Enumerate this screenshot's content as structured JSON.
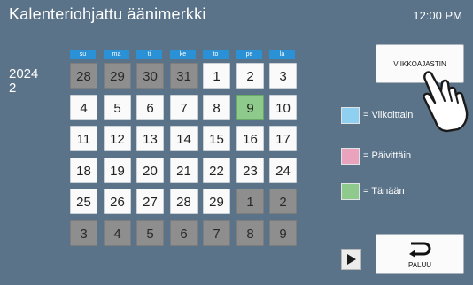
{
  "header": {
    "title": "Kalenteriohjattu äänimerkki",
    "clock": "12:00 PM"
  },
  "calendar": {
    "year": "2024",
    "month": "2",
    "weekdays": [
      "su",
      "ma",
      "ti",
      "ke",
      "to",
      "pe",
      "la"
    ],
    "days": [
      [
        "28",
        "29",
        "30",
        "31",
        "1",
        "2",
        "3"
      ],
      [
        "4",
        "5",
        "6",
        "7",
        "8",
        "9",
        "10"
      ],
      [
        "11",
        "12",
        "13",
        "14",
        "15",
        "16",
        "17"
      ],
      [
        "18",
        "19",
        "20",
        "21",
        "22",
        "23",
        "24"
      ],
      [
        "25",
        "26",
        "27",
        "28",
        "29",
        "1",
        "2"
      ],
      [
        "3",
        "4",
        "5",
        "6",
        "7",
        "8",
        "9"
      ]
    ],
    "other_month": [
      [
        true,
        true,
        true,
        true,
        false,
        false,
        false
      ],
      [
        false,
        false,
        false,
        false,
        false,
        false,
        false
      ],
      [
        false,
        false,
        false,
        false,
        false,
        false,
        false
      ],
      [
        false,
        false,
        false,
        false,
        false,
        false,
        false
      ],
      [
        false,
        false,
        false,
        false,
        false,
        true,
        true
      ],
      [
        true,
        true,
        true,
        true,
        true,
        true,
        true
      ]
    ],
    "today": "9"
  },
  "legend": {
    "weekly": {
      "label": "= Viikoittain",
      "color": "#8fd0f0"
    },
    "daily": {
      "label": "= Päivittäin",
      "color": "#e9a3bd"
    },
    "today": {
      "label": "= Tänään",
      "color": "#8fca8d"
    }
  },
  "buttons": {
    "weekly": "VIIKKOAJASTIN",
    "back": "PALUU",
    "next_icon": "play-triangle-icon",
    "back_icon": "return-arrow-icon"
  },
  "colors": {
    "background": "#5b7388",
    "weekday_header": "#2b91d6",
    "other_month_cell": "#8e8e8e",
    "current_month_cell": "#fafafa"
  },
  "pointer": "hand-pointer-icon"
}
